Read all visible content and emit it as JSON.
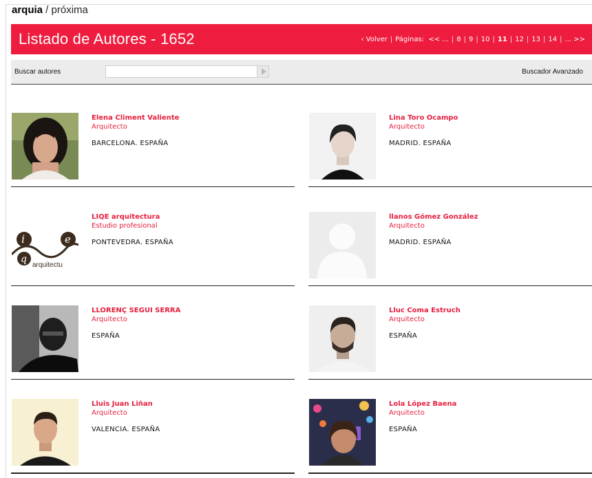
{
  "brand": {
    "name": "arquia",
    "section": "próxima"
  },
  "header": {
    "title": "Listado de Autores - 1652",
    "back_label": "Volver",
    "pages_label": "Páginas:",
    "pages": [
      "<< ...",
      "8",
      "9",
      "10",
      "11",
      "12",
      "13",
      "14",
      "... >>"
    ],
    "current_page": "11"
  },
  "search": {
    "label": "Buscar autores",
    "value": "",
    "placeholder": "",
    "advanced_label": "Buscador Avanzado"
  },
  "authors": [
    {
      "name": "Elena Climent Valiente",
      "role": "Arquitecto",
      "location": "BARCELONA. ESPAÑA",
      "photo": "portrait-woman-dark-hair"
    },
    {
      "name": "Lina Toro Ocampo",
      "role": "Arquitecto",
      "location": "MADRID. ESPAÑA",
      "photo": "portrait-woman-short-hair"
    },
    {
      "name": "LIQE arquitectura",
      "role": "Estudio profesional",
      "location": "PONTEVEDRA. ESPAÑA",
      "photo": "logo-liqe",
      "logo_letters": "i q e",
      "logo_sub": "arquitectu"
    },
    {
      "name": "llanos Gómez González",
      "role": "Arquitecto",
      "location": "MADRID. ESPAÑA",
      "photo": "placeholder-avatar"
    },
    {
      "name": "LLORENÇ SEGUI SERRA",
      "role": "Arquitecto",
      "location": "ESPAÑA",
      "photo": "portrait-man-glasses"
    },
    {
      "name": "Lluc Coma Estruch",
      "role": "Arquitecto",
      "location": "ESPAÑA",
      "photo": "portrait-man-beard"
    },
    {
      "name": "Lluis Juan Liñan",
      "role": "Arquitecto",
      "location": "VALENCIA. ESPAÑA",
      "photo": "portrait-young-man"
    },
    {
      "name": "Lola López Baena",
      "role": "Arquitecto",
      "location": "ESPAÑA",
      "photo": "portrait-woman-city-lights"
    }
  ],
  "colors": {
    "accent": "#ee1c3e",
    "text_accent": "#e51e3d",
    "search_bg": "#ececec"
  }
}
